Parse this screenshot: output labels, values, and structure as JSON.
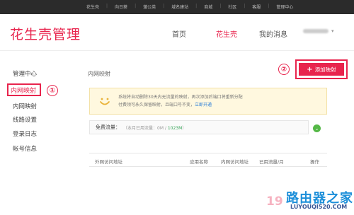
{
  "topbar": {
    "links": [
      "花生壳",
      "向日葵",
      "蒲公英",
      "域名建站",
      "商城",
      "社区",
      "客服",
      "管理中心"
    ]
  },
  "header": {
    "logo": "花生壳管理",
    "nav": [
      "首页",
      "花生壳",
      "我的消息"
    ]
  },
  "sidebar": {
    "items": [
      "管理中心",
      "内网映射",
      "内网映射",
      "线路设置",
      "登录日志",
      "帐号信息"
    ]
  },
  "annotations": [
    "①",
    "②"
  ],
  "content": {
    "title": "内网映射",
    "add_button": "添加映射",
    "notice_line1": "系统将自动删除30天内无流量的映射，再次添加后端口将重新分配",
    "notice_line2_text": "付费领可永久保留映射，且端口号不变，",
    "notice_line2_link": "立即开通",
    "traffic_label": "免费流量：",
    "traffic_prefix": "（本月已用流量：0M / ",
    "traffic_total": "1023M",
    "traffic_suffix": "）",
    "table_headers": [
      "外网访问地址",
      "应用名称",
      "内网访问地址",
      "已用流量/月",
      "操作"
    ]
  },
  "watermark": {
    "number": "19",
    "logo": "路由器之家",
    "url": "LUYOUQI520.COM"
  }
}
